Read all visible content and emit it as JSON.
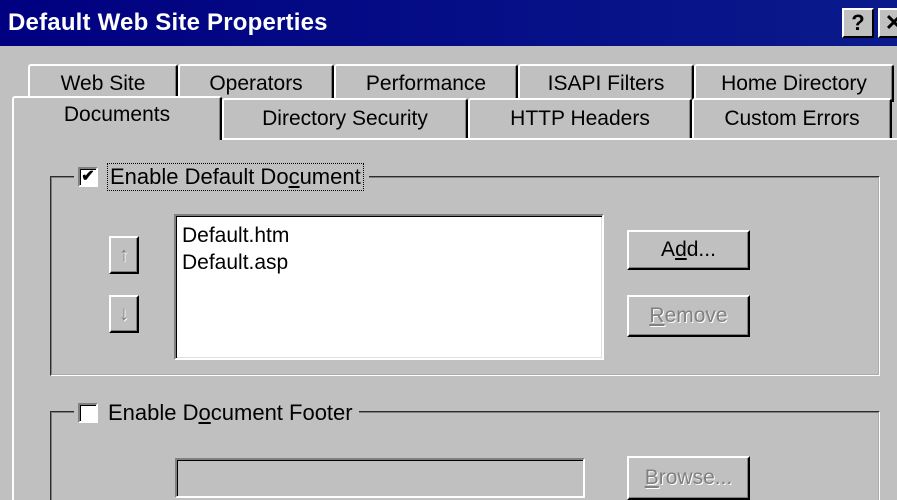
{
  "window": {
    "title": "Default Web Site Properties",
    "help_glyph": "?",
    "close_glyph": "✕"
  },
  "tabs": {
    "row1": [
      "Web Site",
      "Operators",
      "Performance",
      "ISAPI Filters",
      "Home Directory"
    ],
    "row2": [
      "Documents",
      "Directory Security",
      "HTTP Headers",
      "Custom Errors"
    ],
    "active": "Documents"
  },
  "default_document": {
    "checkbox_label_pre": "Enable Default Do",
    "checkbox_label_acc": "c",
    "checkbox_label_post": "ument",
    "checked": true,
    "check_glyph": "✔",
    "items": [
      "Default.htm",
      "Default.asp"
    ],
    "up_glyph": "↑",
    "down_glyph": "↓",
    "add_pre": "A",
    "add_acc": "d",
    "add_post": "d...",
    "remove_acc": "R",
    "remove_post": "emove"
  },
  "footer": {
    "checkbox_label_pre": "Enable D",
    "checkbox_label_acc": "o",
    "checkbox_label_post": "cument Footer",
    "checked": false,
    "input_value": "",
    "browse_acc": "B",
    "browse_post": "rowse..."
  },
  "colors": {
    "titlebar": "#000080",
    "face": "#c0c0c0",
    "disabled_text": "#808080"
  }
}
